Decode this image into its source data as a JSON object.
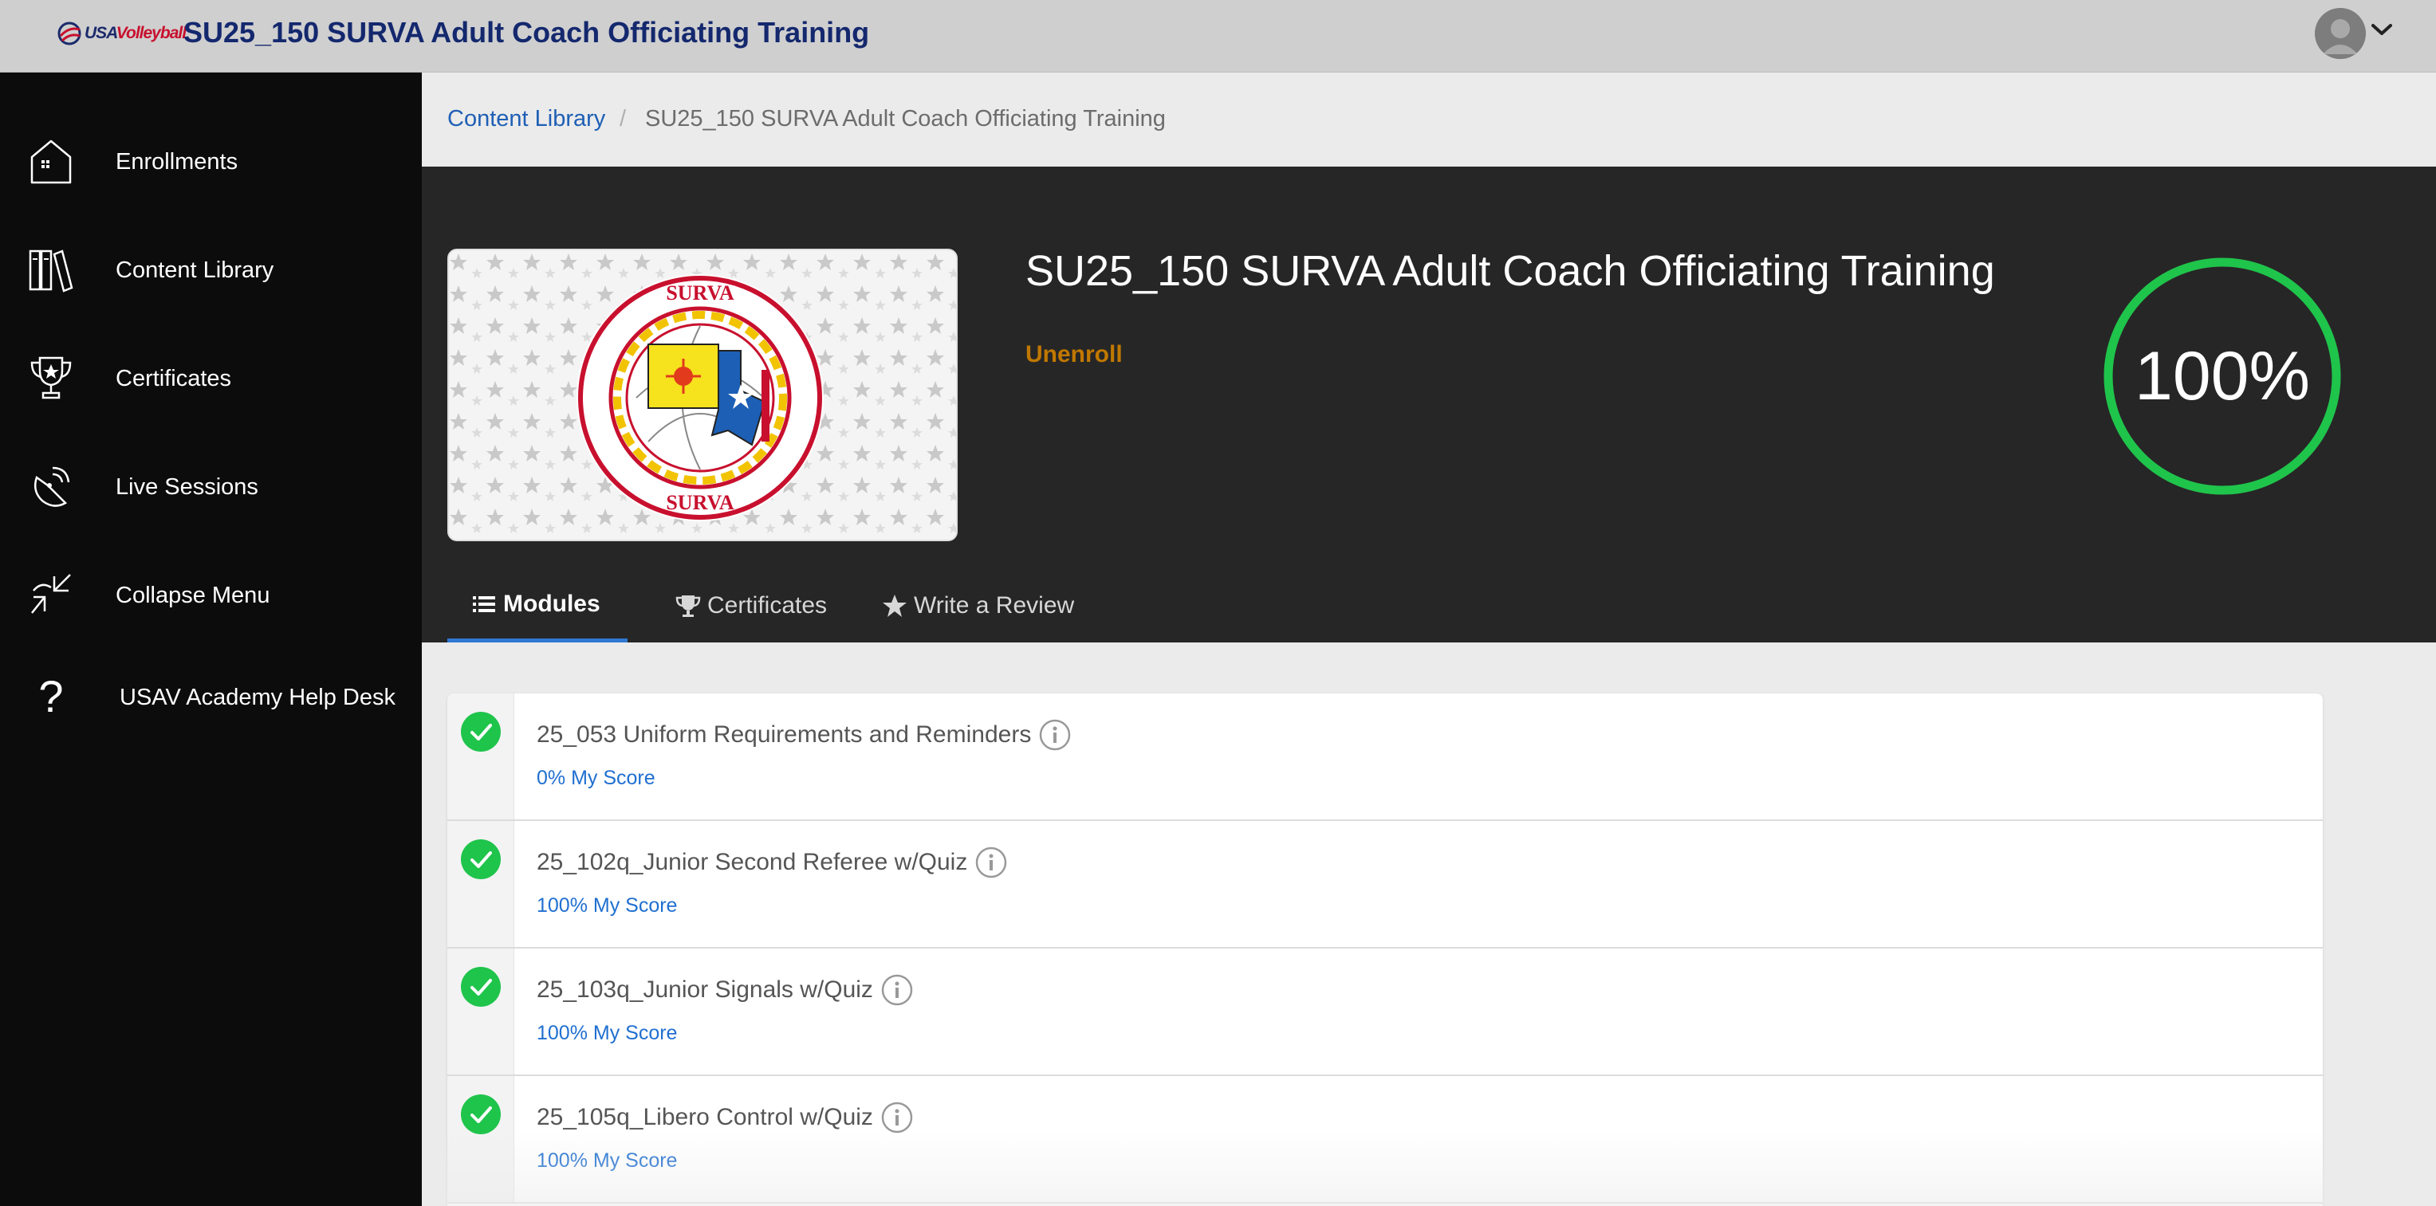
{
  "header": {
    "logo_text_usa": "USA",
    "logo_text_volleyball": "Volleyball",
    "title": "SU25_150 SURVA Adult Coach Officiating Training"
  },
  "sidebar": {
    "items": [
      {
        "label": "Enrollments",
        "icon": "house-icon"
      },
      {
        "label": "Content Library",
        "icon": "books-icon"
      },
      {
        "label": "Certificates",
        "icon": "trophy-icon"
      },
      {
        "label": "Live Sessions",
        "icon": "broadcast-icon"
      },
      {
        "label": "Collapse Menu",
        "icon": "collapse-arrows-icon"
      },
      {
        "label": "USAV Academy Help Desk",
        "icon": "question-mark-icon"
      }
    ]
  },
  "breadcrumb": {
    "link": "Content Library",
    "separator": "/",
    "current": "SU25_150 SURVA Adult Coach Officiating Training"
  },
  "course": {
    "title": "SU25_150 SURVA Adult Coach Officiating Training",
    "unenroll_label": "Unenroll",
    "progress_percent": 100,
    "progress_text": "100%",
    "progress_color": "#1fc44b"
  },
  "tabs": [
    {
      "label": "Modules",
      "icon": "list-icon",
      "active": true
    },
    {
      "label": "Certificates",
      "icon": "trophy-icon",
      "active": false
    },
    {
      "label": "Write a Review",
      "icon": "star-icon",
      "active": false
    }
  ],
  "modules": [
    {
      "title": "25_053 Uniform Requirements and Reminders",
      "score": "0% My Score",
      "status": "complete"
    },
    {
      "title": "25_102q_Junior Second Referee w/Quiz",
      "score": "100% My Score",
      "status": "complete"
    },
    {
      "title": "25_103q_Junior Signals w/Quiz",
      "score": "100% My Score",
      "status": "complete"
    },
    {
      "title": "25_105q_Libero Control w/Quiz",
      "score": "100% My Score",
      "status": "complete"
    }
  ],
  "colors": {
    "accent": "#1f5fb5",
    "complete": "#1fc44b",
    "unenroll": "#c07800",
    "sidebar_bg": "#0c0c0c",
    "hero_bg": "#262626"
  }
}
